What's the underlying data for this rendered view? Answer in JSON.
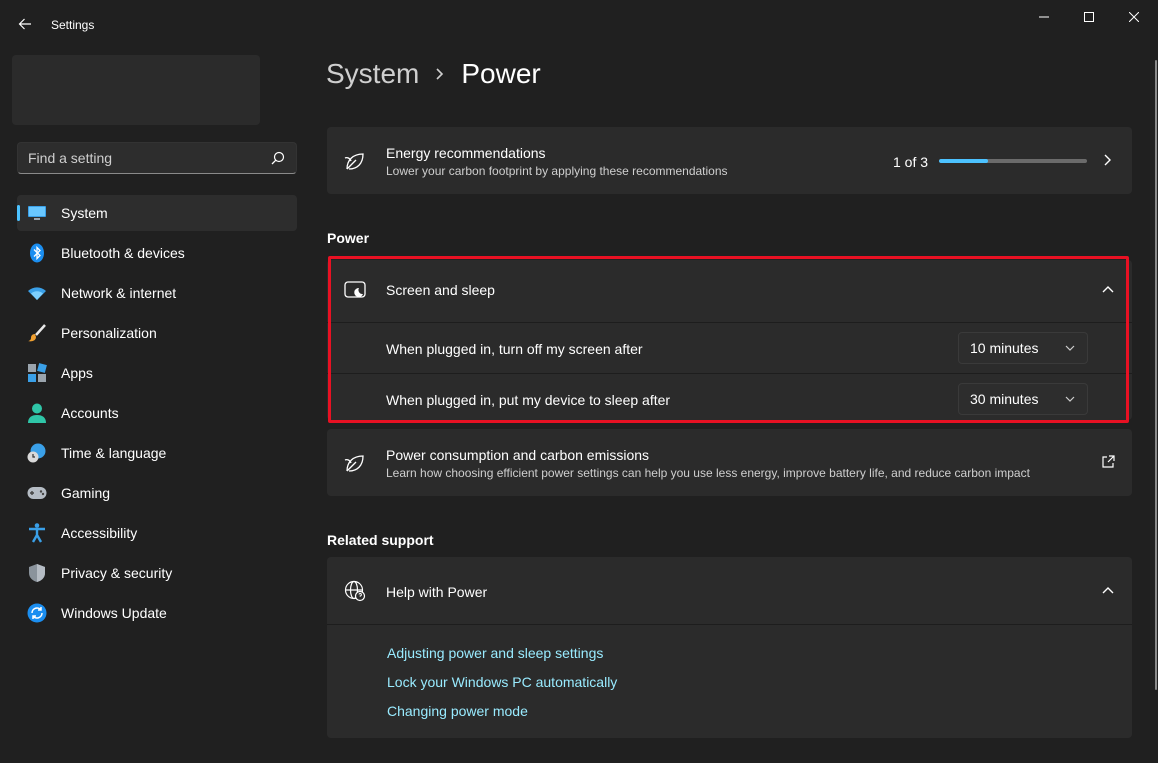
{
  "window": {
    "title": "Settings"
  },
  "search": {
    "placeholder": "Find a setting"
  },
  "sidebar": {
    "items": [
      {
        "label": "System",
        "icon": "monitor-icon",
        "selected": true
      },
      {
        "label": "Bluetooth & devices",
        "icon": "bluetooth-icon"
      },
      {
        "label": "Network & internet",
        "icon": "wifi-icon"
      },
      {
        "label": "Personalization",
        "icon": "paintbrush-icon"
      },
      {
        "label": "Apps",
        "icon": "apps-icon"
      },
      {
        "label": "Accounts",
        "icon": "person-icon"
      },
      {
        "label": "Time & language",
        "icon": "globe-clock-icon"
      },
      {
        "label": "Gaming",
        "icon": "gamepad-icon"
      },
      {
        "label": "Accessibility",
        "icon": "accessibility-icon"
      },
      {
        "label": "Privacy & security",
        "icon": "shield-icon"
      },
      {
        "label": "Windows Update",
        "icon": "update-icon"
      }
    ]
  },
  "breadcrumb": {
    "parent": "System",
    "current": "Power"
  },
  "energy": {
    "title": "Energy recommendations",
    "subtitle": "Lower your carbon footprint by applying these recommendations",
    "progress_label": "1 of 3",
    "progress_fraction": 0.333
  },
  "power_section": {
    "heading": "Power"
  },
  "screen_sleep": {
    "title": "Screen and sleep",
    "screen_off_label": "When plugged in, turn off my screen after",
    "screen_off_value": "10 minutes",
    "sleep_label": "When plugged in, put my device to sleep after",
    "sleep_value": "30 minutes"
  },
  "consumption": {
    "title": "Power consumption and carbon emissions",
    "subtitle": "Learn how choosing efficient power settings can help you use less energy, improve battery life, and reduce carbon impact"
  },
  "related": {
    "heading": "Related support",
    "help_title": "Help with Power",
    "links": [
      "Adjusting power and sleep settings",
      "Lock your Windows PC automatically",
      "Changing power mode"
    ]
  },
  "colors": {
    "background": "#202020",
    "card": "#2b2b2b",
    "accent": "#4cc2ff",
    "link": "#99ebff",
    "highlight": "#e81123"
  }
}
